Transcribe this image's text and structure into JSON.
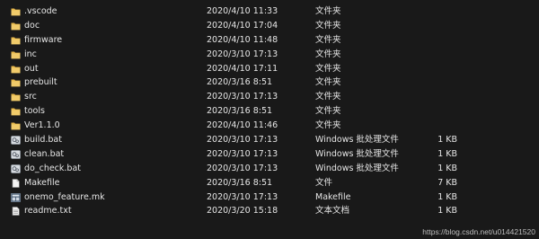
{
  "files": [
    {
      "name": ".vscode",
      "date": "2020/4/10 11:33",
      "type": "文件夹",
      "size": "",
      "icon": "folder-icon"
    },
    {
      "name": "doc",
      "date": "2020/4/10 17:04",
      "type": "文件夹",
      "size": "",
      "icon": "folder-icon"
    },
    {
      "name": "firmware",
      "date": "2020/4/10 11:48",
      "type": "文件夹",
      "size": "",
      "icon": "folder-icon"
    },
    {
      "name": "inc",
      "date": "2020/3/10 17:13",
      "type": "文件夹",
      "size": "",
      "icon": "folder-icon"
    },
    {
      "name": "out",
      "date": "2020/4/10 17:11",
      "type": "文件夹",
      "size": "",
      "icon": "folder-icon"
    },
    {
      "name": "prebuilt",
      "date": "2020/3/16 8:51",
      "type": "文件夹",
      "size": "",
      "icon": "folder-icon"
    },
    {
      "name": "src",
      "date": "2020/3/10 17:13",
      "type": "文件夹",
      "size": "",
      "icon": "folder-icon"
    },
    {
      "name": "tools",
      "date": "2020/3/16 8:51",
      "type": "文件夹",
      "size": "",
      "icon": "folder-icon"
    },
    {
      "name": "Ver1.1.0",
      "date": "2020/4/10 11:46",
      "type": "文件夹",
      "size": "",
      "icon": "folder-icon"
    },
    {
      "name": "build.bat",
      "date": "2020/3/10 17:13",
      "type": "Windows 批处理文件",
      "size": "1 KB",
      "icon": "batch-file-icon"
    },
    {
      "name": "clean.bat",
      "date": "2020/3/10 17:13",
      "type": "Windows 批处理文件",
      "size": "1 KB",
      "icon": "batch-file-icon"
    },
    {
      "name": "do_check.bat",
      "date": "2020/3/10 17:13",
      "type": "Windows 批处理文件",
      "size": "1 KB",
      "icon": "batch-file-icon"
    },
    {
      "name": "Makefile",
      "date": "2020/3/16 8:51",
      "type": "文件",
      "size": "7 KB",
      "icon": "file-icon"
    },
    {
      "name": "onemo_feature.mk",
      "date": "2020/3/10 17:13",
      "type": "Makefile",
      "size": "1 KB",
      "icon": "makefile-icon"
    },
    {
      "name": "readme.txt",
      "date": "2020/3/20 15:18",
      "type": "文本文档",
      "size": "1 KB",
      "icon": "text-file-icon"
    }
  ],
  "watermark": "https://blog.csdn.net/u014421520",
  "colors": {
    "background": "#191919",
    "text": "#e6e6e6",
    "folder": "#e8b84a"
  }
}
